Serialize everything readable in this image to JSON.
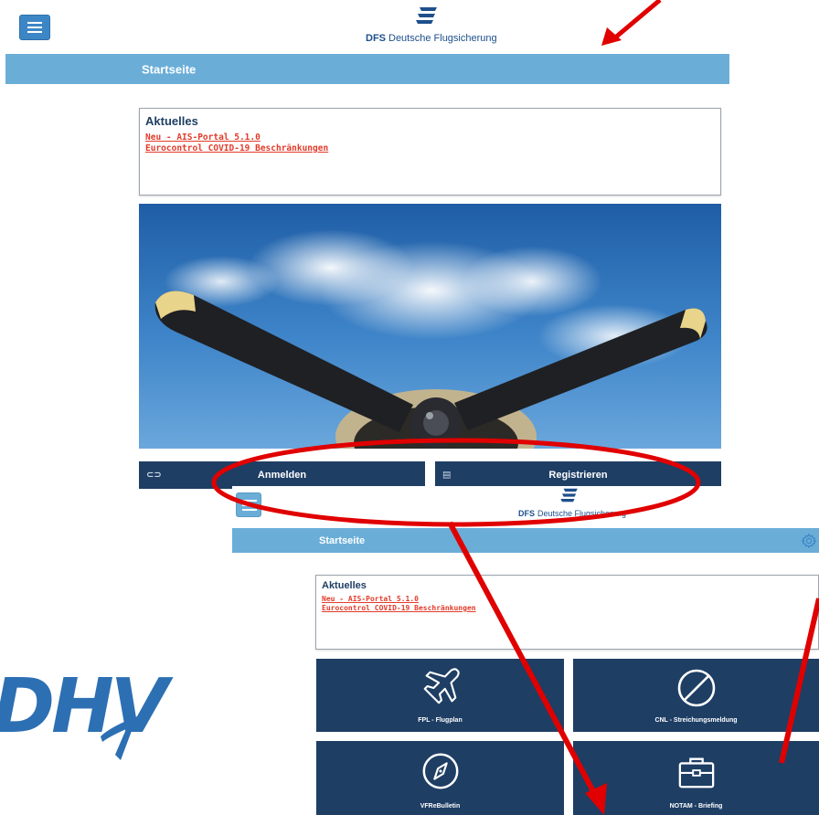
{
  "screen1": {
    "brand_abbr": "DFS",
    "brand_name": "Deutsche Flugsicherung",
    "page_title": "Startseite",
    "news": {
      "title": "Aktuelles",
      "links": [
        "Neu - AIS-Portal 5.1.0",
        "Eurocontrol COVID-19 Beschränkungen"
      ]
    },
    "buttons": {
      "login": "Anmelden",
      "register": "Registrieren"
    }
  },
  "screen2": {
    "brand_abbr": "DFS",
    "brand_name": "Deutsche Flugsicherung",
    "page_title": "Startseite",
    "news": {
      "title": "Aktuelles",
      "links": [
        "Neu - AIS-Portal 5.1.0",
        "Eurocontrol COVID-19 Beschränkungen"
      ]
    },
    "tiles": [
      {
        "label": "FPL - Flugplan",
        "icon": "airplane-icon"
      },
      {
        "label": "CNL - Streichungsmeldung",
        "icon": "prohibited-icon"
      },
      {
        "label": "VFReBulletin",
        "icon": "compass-icon"
      },
      {
        "label": "NOTAM - Briefing",
        "icon": "briefcase-icon"
      }
    ]
  },
  "dhv_logo": "DHV",
  "colors": {
    "title_bar": "#6aaed8",
    "dark_navy": "#1e3e64",
    "menu_blue": "#3d86c6",
    "link_red": "#e23b2a",
    "annotation_red": "#e00000",
    "dhv_blue": "#2d6fb3"
  }
}
